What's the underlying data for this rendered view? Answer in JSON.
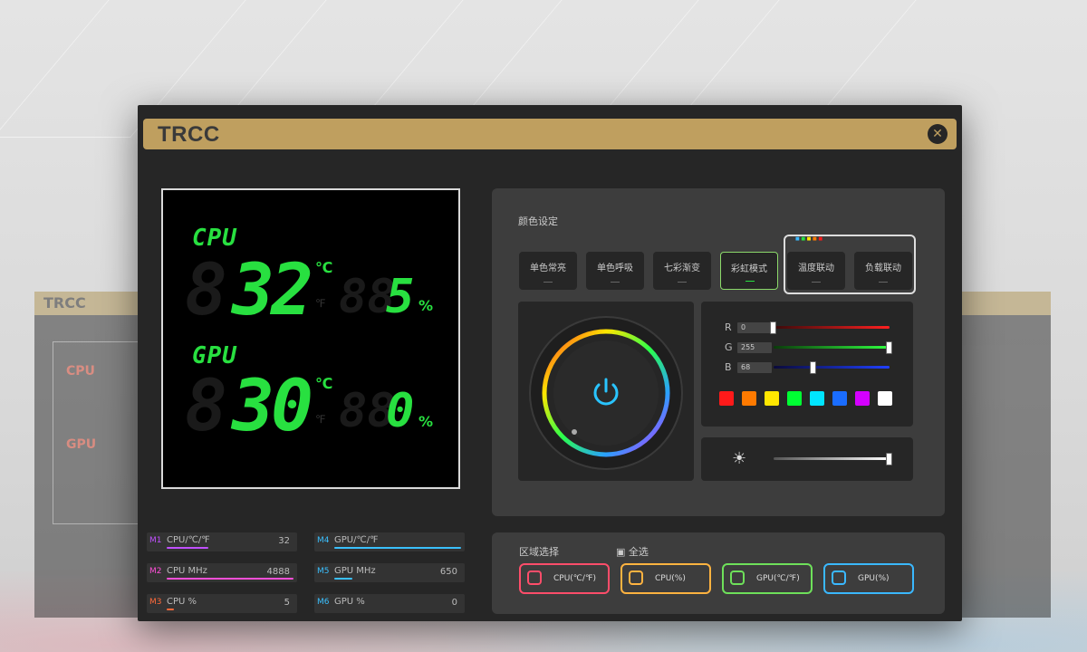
{
  "app": {
    "title": "TRCC",
    "close_icon": "close-icon"
  },
  "display": {
    "cpu": {
      "label": "CPU",
      "temp": "32",
      "temp_unit": "℃",
      "load": "5",
      "load_unit": "%"
    },
    "gpu": {
      "label": "GPU",
      "temp": "30",
      "temp_unit": "℃",
      "load": "0",
      "load_unit": "%"
    },
    "theme_color": "#28e040"
  },
  "metrics": [
    {
      "tag": "M1",
      "name": "CPU/℃/℉",
      "value": "32",
      "color": "#c050ff"
    },
    {
      "tag": "M2",
      "name": "CPU MHz",
      "value": "4888",
      "color": "#ff4fd8"
    },
    {
      "tag": "M3",
      "name": "CPU %",
      "value": "5",
      "color": "#ff6a3a"
    },
    {
      "tag": "M4",
      "name": "GPU/℃/℉",
      "value": "",
      "color": "#3ac0ff"
    },
    {
      "tag": "M5",
      "name": "GPU MHz",
      "value": "650",
      "color": "#3ac0ff"
    },
    {
      "tag": "M6",
      "name": "GPU %",
      "value": "0",
      "color": "#3ac0ff"
    }
  ],
  "color_settings": {
    "title": "颜色设定",
    "modes": [
      {
        "label": "单色常亮"
      },
      {
        "label": "单色呼吸"
      },
      {
        "label": "七彩渐变"
      },
      {
        "label": "彩虹模式"
      },
      {
        "label": "温度联动"
      },
      {
        "label": "负载联动"
      }
    ],
    "active_mode": "彩虹模式",
    "rgb": {
      "r_label": "R",
      "g_label": "G",
      "b_label": "B",
      "r": "0",
      "g": "255",
      "b": "68"
    },
    "presets": [
      "#ff1a1a",
      "#ff7a00",
      "#ffe600",
      "#00ff33",
      "#00e5ff",
      "#1a6dff",
      "#d400ff",
      "#ffffff"
    ],
    "brightness_icon": "brightness-icon",
    "power_icon": "power-icon"
  },
  "zones": {
    "title": "区域选择",
    "select_all": "全选",
    "buttons": [
      {
        "label": "CPU(℃/℉)",
        "color": "#ff4d6a"
      },
      {
        "label": "CPU(%)",
        "color": "#ffb340"
      },
      {
        "label": "GPU(℃/℉)",
        "color": "#6ee05a"
      },
      {
        "label": "GPU(%)",
        "color": "#3ab8ff"
      }
    ]
  },
  "ghost_window": {
    "title": "TRCC",
    "cpu_label": "CPU",
    "gpu_label": "GPU"
  }
}
